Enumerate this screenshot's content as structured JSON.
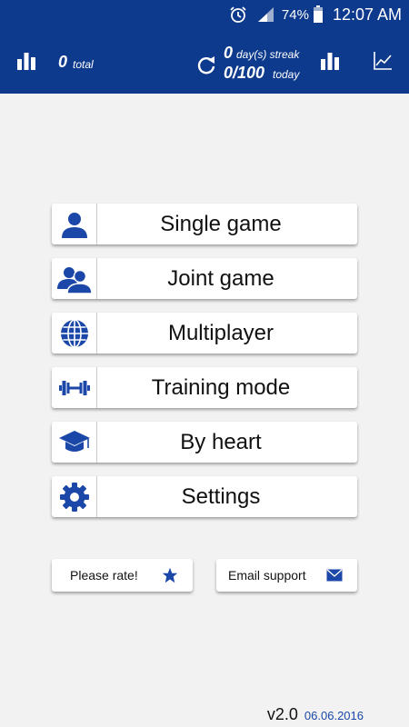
{
  "status_bar": {
    "battery_percent": "74%",
    "time": "12:07 AM",
    "icons": [
      "alarm-icon",
      "signal-icon",
      "battery-icon"
    ]
  },
  "header": {
    "total_value": "0",
    "total_label": "total",
    "streak_value": "0",
    "streak_label": "day(s) streak",
    "today_value": "0/100",
    "today_label": "today",
    "icons": [
      "bar-chart-icon",
      "refresh-icon",
      "bar-chart-icon",
      "line-graph-icon"
    ]
  },
  "menu": {
    "items": [
      {
        "label": "Single game",
        "icon": "user-icon"
      },
      {
        "label": "Joint game",
        "icon": "users-icon"
      },
      {
        "label": "Multiplayer",
        "icon": "globe-icon"
      },
      {
        "label": "Training mode",
        "icon": "dumbbell-icon"
      },
      {
        "label": "By heart",
        "icon": "graduation-cap-icon"
      },
      {
        "label": "Settings",
        "icon": "gear-icon"
      }
    ]
  },
  "footer_buttons": {
    "rate_label": "Please rate!",
    "email_label": "Email support"
  },
  "version": {
    "number": "v2.0",
    "date": "06.06.2016"
  },
  "colors": {
    "brand_blue": "#0d3a8c",
    "icon_blue": "#1a47a8",
    "background": "#f2f2f2"
  }
}
